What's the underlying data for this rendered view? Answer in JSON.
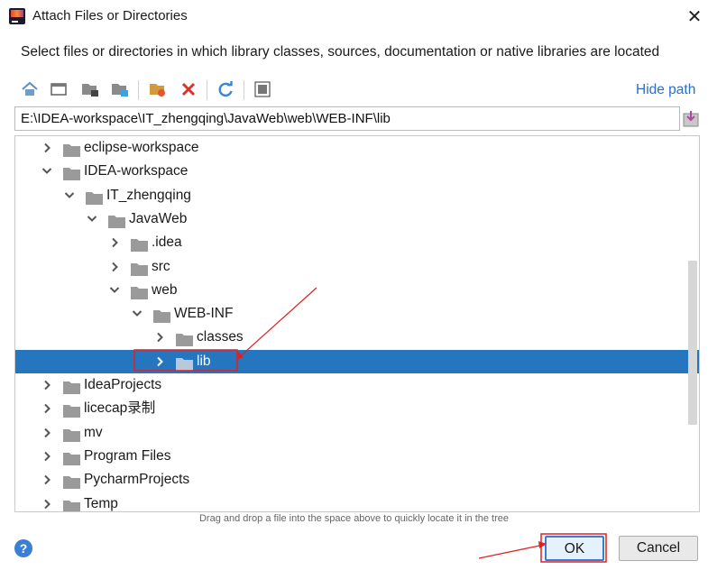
{
  "window": {
    "title": "Attach Files or Directories",
    "close_glyph": "✕"
  },
  "description": "Select files or directories in which library classes, sources, documentation or native libraries are located",
  "toolbar": {
    "buttons": [
      "home-icon",
      "desktop-icon",
      "project-folder-icon",
      "module-folder-icon",
      "new-folder-icon",
      "delete-icon",
      "refresh-icon",
      "show-hidden-icon"
    ],
    "hide_path_label": "Hide path"
  },
  "path_field": {
    "value": "E:\\IDEA-workspace\\IT_zhengqing\\JavaWeb\\web\\WEB-INF\\lib"
  },
  "tree": {
    "rows": [
      {
        "label": "eclipse-workspace",
        "expanded": false,
        "depth": 0
      },
      {
        "label": "IDEA-workspace",
        "expanded": true,
        "depth": 0
      },
      {
        "label": "IT_zhengqing",
        "expanded": true,
        "depth": 1
      },
      {
        "label": "JavaWeb",
        "expanded": true,
        "depth": 2
      },
      {
        "label": ".idea",
        "expanded": false,
        "depth": 3
      },
      {
        "label": "src",
        "expanded": false,
        "depth": 3
      },
      {
        "label": "web",
        "expanded": true,
        "depth": 3
      },
      {
        "label": "WEB-INF",
        "expanded": true,
        "depth": 4
      },
      {
        "label": "classes",
        "expanded": false,
        "depth": 5
      },
      {
        "label": "lib",
        "expanded": false,
        "depth": 5,
        "selected": true
      },
      {
        "label": "IdeaProjects",
        "expanded": false,
        "depth": 0
      },
      {
        "label": "licecap录制",
        "expanded": false,
        "depth": 0
      },
      {
        "label": "mv",
        "expanded": false,
        "depth": 0
      },
      {
        "label": "Program Files",
        "expanded": false,
        "depth": 0
      },
      {
        "label": "PycharmProjects",
        "expanded": false,
        "depth": 0
      },
      {
        "label": "Temp",
        "expanded": false,
        "depth": 0
      }
    ]
  },
  "hint": "Drag and drop a file into the space above to quickly locate it in the tree",
  "help_glyph": "?",
  "buttons": {
    "ok_label": "OK",
    "cancel_label": "Cancel"
  },
  "colors": {
    "selection": "#2675bf",
    "link": "#2a6fc9",
    "annotation": "#e02020",
    "folder": "#9a9a9a"
  }
}
